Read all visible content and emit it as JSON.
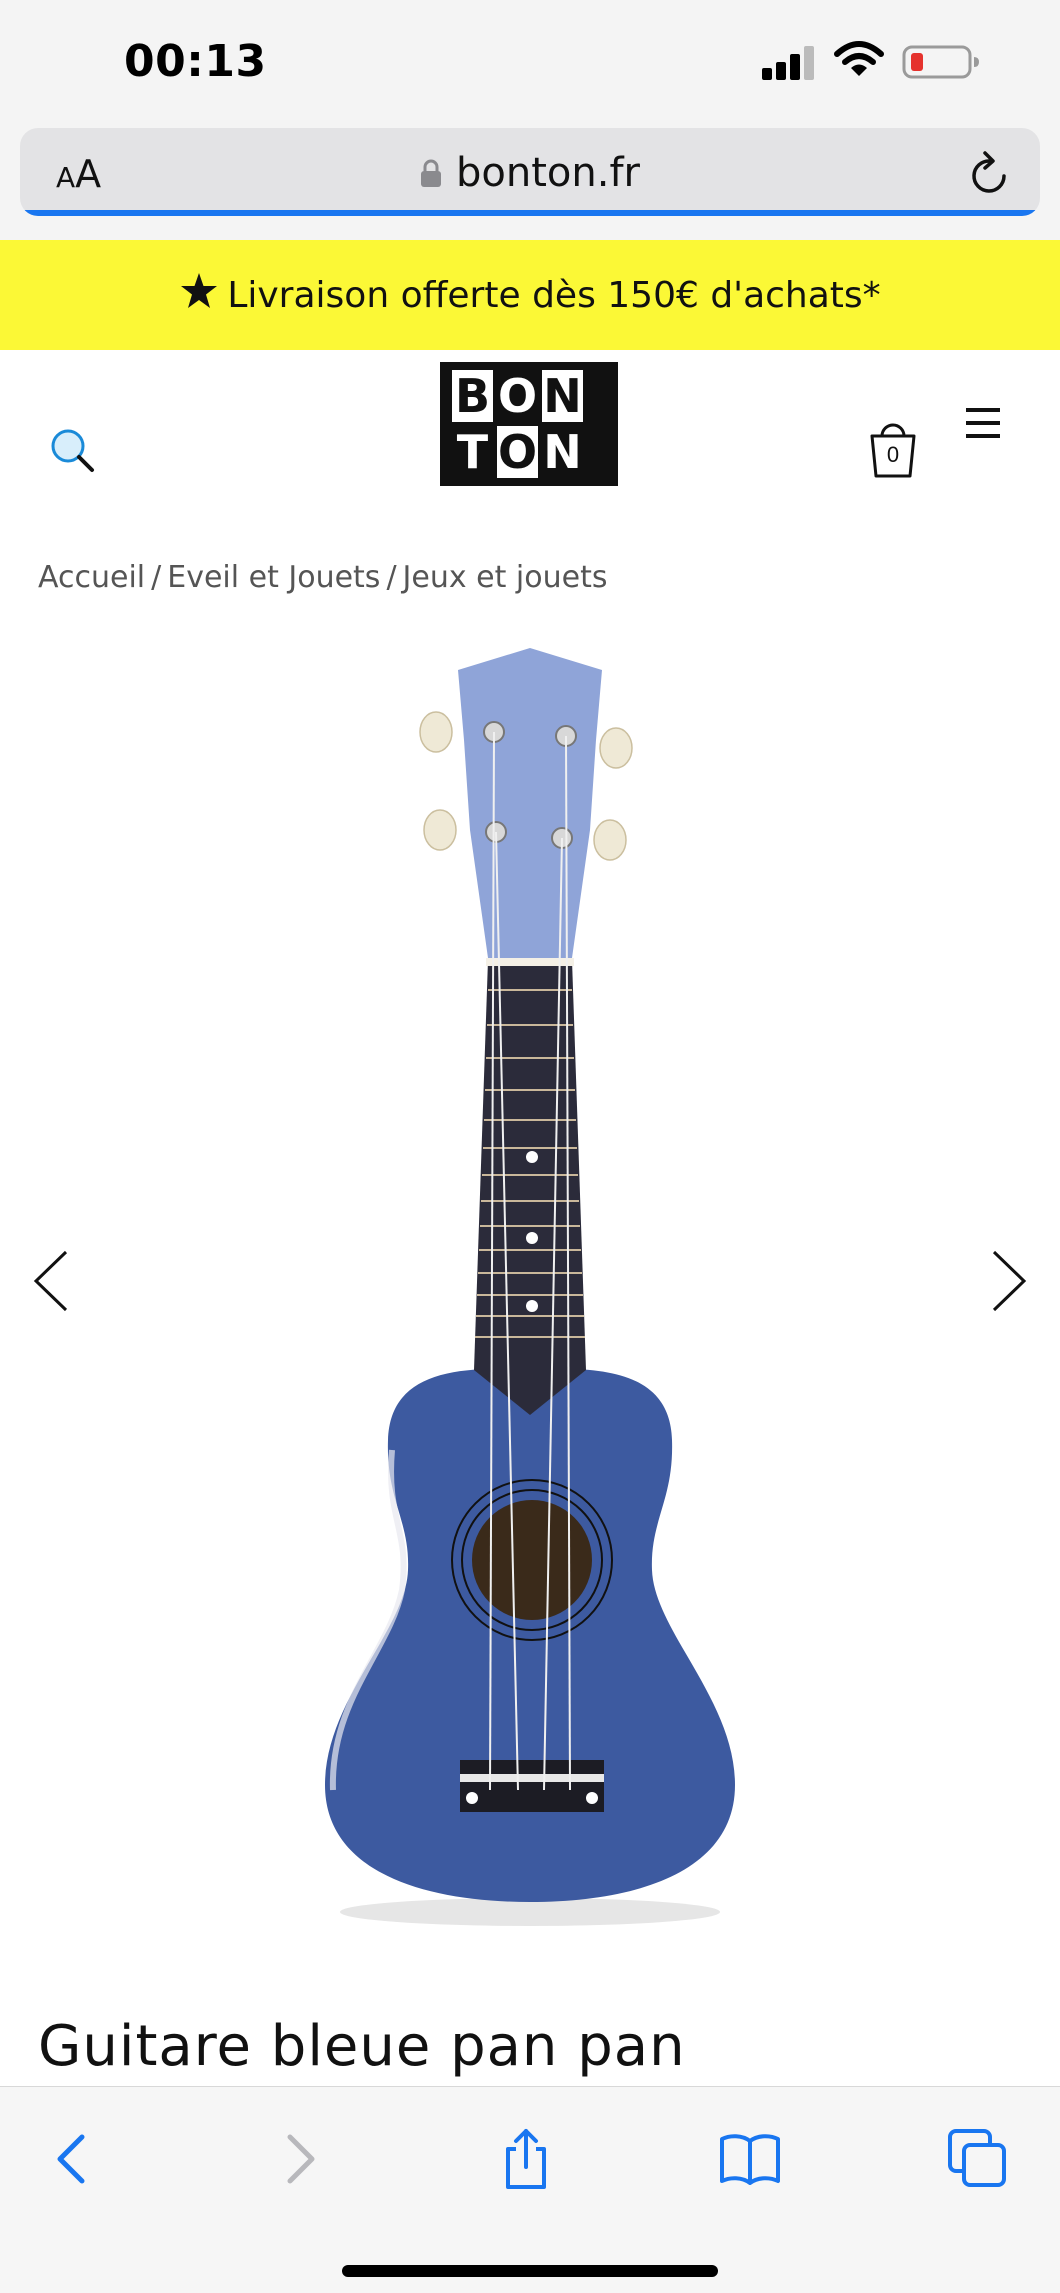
{
  "status_bar": {
    "time": "00:13"
  },
  "address_bar": {
    "aa_label_small": "A",
    "aa_label_large": "A",
    "url": "bonton.fr",
    "load_progress": 1.0
  },
  "promo": {
    "text": "Livraison offerte dès 150€ d'achats*"
  },
  "header": {
    "logo_letters": [
      "B",
      "O",
      "N",
      "T",
      "O",
      "N"
    ],
    "cart_count": "0"
  },
  "breadcrumb": {
    "items": [
      "Accueil",
      "Eveil et Jouets",
      "Jeux et jouets"
    ],
    "separator": "/"
  },
  "product": {
    "title": "Guitare bleue pan pan",
    "image_icon": "ukulele-image",
    "body_color": "#3d5aa0"
  },
  "colors": {
    "accent": "#1976f0",
    "promo_bg": "#fbf836",
    "battery_low": "#e5322d"
  }
}
